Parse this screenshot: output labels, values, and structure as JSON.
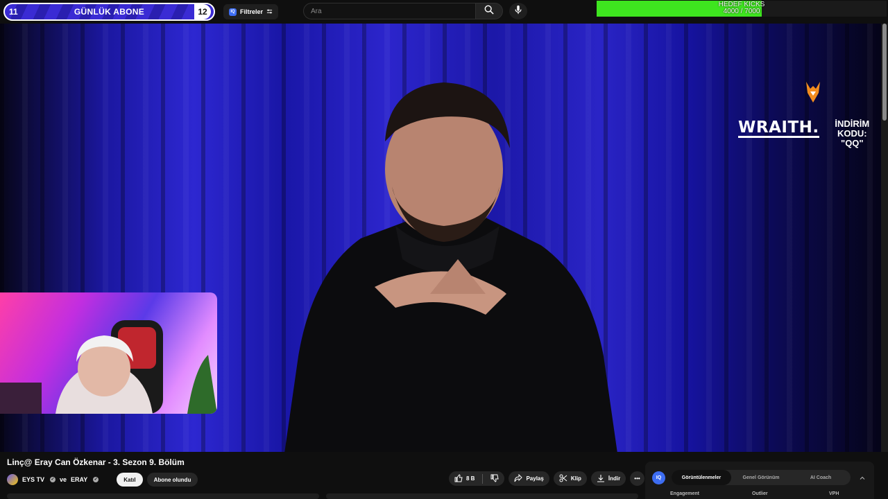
{
  "subscriber_goal": {
    "left_count": "11",
    "label": "GÜNLÜK ABONE",
    "right_count": "12"
  },
  "filters": {
    "badge": "IQ",
    "label": "Filtreler"
  },
  "search": {
    "placeholder": "Ara"
  },
  "kick_goal": {
    "title": "HEDEF KICKS",
    "progress_text": "4000 / 7000",
    "progress": 0.57
  },
  "sponsor": {
    "brand": "WRAITH.",
    "code_label": "İNDİRİM KODU:",
    "code": "\"QQ\""
  },
  "video": {
    "title": "Linç@ Eray Can Özkenar - 3. Sezon 9. Bölüm",
    "channel": "EYS TV",
    "channel_joiner": "ve",
    "collab": "ERAY",
    "join_label": "Katıl",
    "subscribed_label": "Abone olundu"
  },
  "actions": {
    "likes": "8 B",
    "share": "Paylaş",
    "clip": "Klip",
    "download": "İndir"
  },
  "analytics_panel": {
    "badge": "IQ",
    "tabs": [
      "Görüntülenmeler",
      "Genel Görünüm",
      "AI Coach"
    ],
    "columns": [
      "Engagement",
      "Outlier",
      "VPH"
    ]
  },
  "colors": {
    "accent_blue": "#3d6df2",
    "goal_green": "#3ee51f",
    "sub_purple": "#3a2bd4",
    "curtain_blue": "#2d27d1"
  }
}
